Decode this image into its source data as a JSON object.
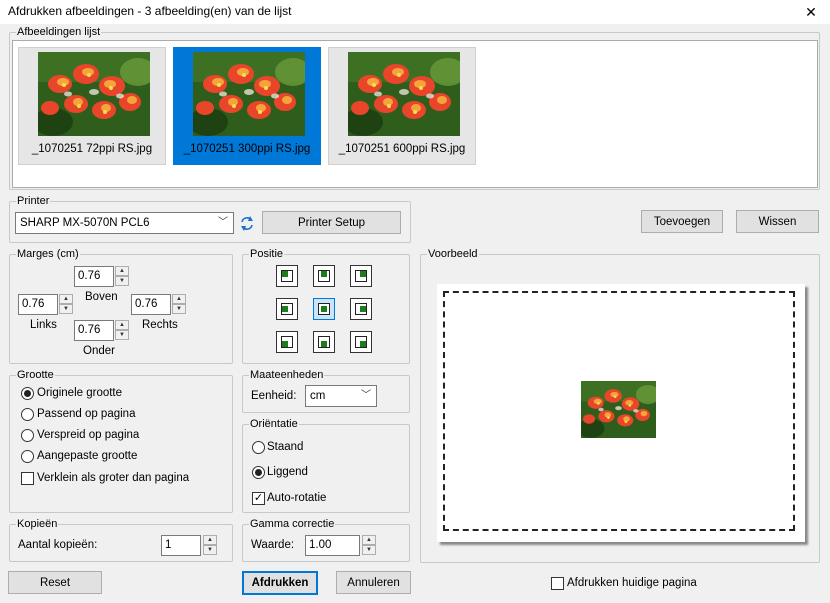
{
  "window": {
    "title": "Afdrukken afbeeldingen  -  3 afbeelding(en) van de lijst",
    "close_icon": "close-icon"
  },
  "images_list": {
    "legend": "Afbeeldingen lijst",
    "items": [
      {
        "label": "_1070251 72ppi RS.jpg",
        "selected": false
      },
      {
        "label": "_1070251 300ppi RS.jpg",
        "selected": true
      },
      {
        "label": "_1070251 600ppi RS.jpg",
        "selected": false
      }
    ]
  },
  "printer": {
    "legend": "Printer",
    "selected": "SHARP MX-5070N PCL6",
    "refresh_icon": "refresh-icon",
    "setup_label": "Printer Setup"
  },
  "list_buttons": {
    "add_label": "Toevoegen",
    "remove_label": "Wissen"
  },
  "margins": {
    "legend": "Marges (cm)",
    "top_value": "0.76",
    "top_label": "Boven",
    "left_value": "0.76",
    "left_label": "Links",
    "right_value": "0.76",
    "right_label": "Rechts",
    "bottom_value": "0.76",
    "bottom_label": "Onder"
  },
  "position": {
    "legend": "Positie",
    "selected_index": 4
  },
  "size": {
    "legend": "Grootte",
    "options": [
      "Originele grootte",
      "Passend op pagina",
      "Verspreid op pagina",
      "Aangepaste grootte"
    ],
    "selected_index": 0,
    "shrink_label": "Verklein als groter dan pagina",
    "shrink_checked": false
  },
  "units": {
    "legend": "Maateenheden",
    "label": "Eenheid:",
    "value": "cm"
  },
  "orientation": {
    "legend": "Oriëntatie",
    "portrait_label": "Staand",
    "landscape_label": "Liggend",
    "selected": "landscape",
    "autorotate_label": "Auto-rotatie",
    "autorotate_checked": true
  },
  "copies": {
    "legend": "Kopieën",
    "label": "Aantal kopieën:",
    "value": "1"
  },
  "gamma": {
    "legend": "Gamma correctie",
    "label": "Waarde:",
    "value": "1.00"
  },
  "preview": {
    "legend": "Voorbeeld"
  },
  "footer": {
    "reset_label": "Reset",
    "print_label": "Afdrukken",
    "cancel_label": "Annuleren",
    "print_current_label": "Afdrukken huidige pagina",
    "print_current_checked": false
  },
  "colors": {
    "accent": "#0078d7",
    "background": "#f0f0f0"
  }
}
